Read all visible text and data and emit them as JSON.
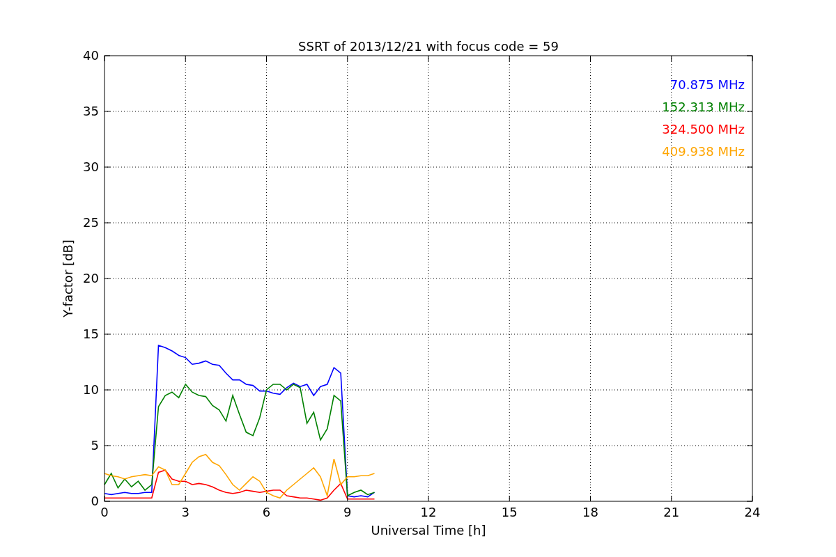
{
  "chart_data": {
    "type": "line",
    "grid": true,
    "title": "SSRT of 2013/12/21 with focus code = 59",
    "xlabel": "Universal Time [h]",
    "ylabel": "Y-factor [dB]",
    "xlim": [
      0,
      24
    ],
    "ylim": [
      0,
      40
    ],
    "xticks": [
      0,
      3,
      6,
      9,
      12,
      15,
      18,
      21,
      24
    ],
    "yticks": [
      0,
      5,
      10,
      15,
      20,
      25,
      30,
      35,
      40
    ],
    "x": [
      0,
      0.25,
      0.5,
      0.75,
      1,
      1.25,
      1.5,
      1.75,
      2,
      2.25,
      2.5,
      2.75,
      3,
      3.25,
      3.5,
      3.75,
      4,
      4.25,
      4.5,
      4.75,
      5,
      5.25,
      5.5,
      5.75,
      6,
      6.25,
      6.5,
      6.75,
      7,
      7.25,
      7.5,
      7.75,
      8,
      8.25,
      8.5,
      8.75,
      9,
      9.25,
      9.5,
      9.75,
      10
    ],
    "series": [
      {
        "name": "70.875 MHz",
        "color": "#0000ff",
        "values": [
          0.7,
          0.6,
          0.7,
          0.8,
          0.7,
          0.7,
          0.8,
          0.8,
          14,
          13.8,
          13.5,
          13.1,
          12.9,
          12.3,
          12.4,
          12.6,
          12.3,
          12.2,
          11.5,
          10.9,
          10.9,
          10.5,
          10.4,
          9.9,
          9.9,
          9.7,
          9.6,
          10.2,
          10.6,
          10.3,
          10.5,
          9.5,
          10.3,
          10.5,
          12,
          11.5,
          0.5,
          0.4,
          0.5,
          0.4,
          0.8
        ]
      },
      {
        "name": "152.313 MHz",
        "color": "#008000",
        "values": [
          1.5,
          2.5,
          1.2,
          2,
          1.3,
          1.8,
          1,
          1.5,
          8.5,
          9.5,
          9.8,
          9.3,
          10.5,
          9.8,
          9.5,
          9.4,
          8.6,
          8.2,
          7.2,
          9.5,
          7.8,
          6.2,
          5.9,
          7.5,
          10,
          10.5,
          10.5,
          10,
          10.5,
          10.2,
          7,
          8,
          5.5,
          6.5,
          9.5,
          9,
          0.5,
          0.8,
          1,
          0.6,
          0.8
        ]
      },
      {
        "name": "324.500 MHz",
        "color": "#ff0000",
        "values": [
          0.3,
          0.3,
          0.3,
          0.3,
          0.3,
          0.3,
          0.3,
          0.3,
          2.6,
          2.8,
          2,
          1.8,
          1.8,
          1.5,
          1.6,
          1.5,
          1.3,
          1,
          0.8,
          0.7,
          0.8,
          1,
          0.9,
          0.8,
          0.9,
          1,
          1,
          0.5,
          0.4,
          0.3,
          0.3,
          0.2,
          0.1,
          0.3,
          1,
          1.6,
          0.2,
          0.2,
          0.2,
          0.2,
          0.2
        ]
      },
      {
        "name": "409.938 MHz",
        "color": "#ffa500",
        "values": [
          2.5,
          2.3,
          2.2,
          2,
          2.2,
          2.3,
          2.4,
          2.3,
          3.1,
          2.8,
          1.5,
          1.5,
          2.5,
          3.5,
          4,
          4.2,
          3.5,
          3.2,
          2.4,
          1.5,
          1,
          1.6,
          2.2,
          1.8,
          0.8,
          0.5,
          0.3,
          1,
          1.5,
          2,
          2.5,
          3,
          2.2,
          0.5,
          3.8,
          1.5,
          2.2,
          2.2,
          2.3,
          2.3,
          2.5
        ]
      }
    ]
  }
}
